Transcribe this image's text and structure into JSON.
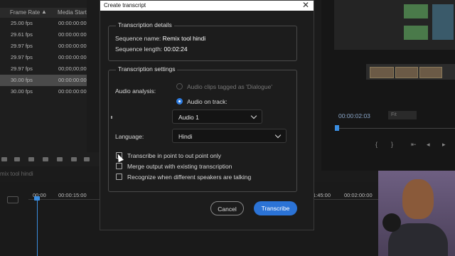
{
  "project_panel": {
    "columns": [
      "Frame Rate",
      "Media Start"
    ],
    "rows": [
      {
        "frame_rate": "25.00 fps",
        "media_start": "00:00:00:00"
      },
      {
        "frame_rate": "29.61 fps",
        "media_start": "00:00:00:00"
      },
      {
        "frame_rate": "29.97 fps",
        "media_start": "00:00:00:00"
      },
      {
        "frame_rate": "29.97 fps",
        "media_start": "00:00:00:00"
      },
      {
        "frame_rate": "29.97 fps",
        "media_start": "00;00;00;00"
      },
      {
        "frame_rate": "30.00 fps",
        "media_start": "00:00:00:00"
      },
      {
        "frame_rate": "30.00 fps",
        "media_start": "00:00:00:00"
      }
    ]
  },
  "timeline": {
    "sequence_tab": "mix tool hindi",
    "timecodes": [
      "00:00",
      "00:00:15:00",
      "1:45:00",
      "00:02:00:00"
    ]
  },
  "monitor": {
    "timecode": "00:00:02:03",
    "zoom": "Fit"
  },
  "dialog": {
    "title": "Create transcript",
    "close_glyph": "✕",
    "details": {
      "legend": "Transcription details",
      "sequence_name_label": "Sequence name:",
      "sequence_name_value": "Remix tool hindi",
      "sequence_length_label": "Sequence length:",
      "sequence_length_value": "00:02:24"
    },
    "settings": {
      "legend": "Transcription settings",
      "audio_analysis_label": "Audio analysis:",
      "option_clips_tagged": "Audio clips tagged as 'Dialogue'",
      "option_audio_on_track": "Audio on track:",
      "track_value": "Audio 1",
      "language_label": "Language:",
      "language_value": "Hindi",
      "check_in_out": "Transcribe in point to out point only",
      "check_merge": "Merge output with existing transcription",
      "check_speakers": "Recognize when different speakers are talking"
    },
    "cancel_label": "Cancel",
    "transcribe_label": "Transcribe"
  },
  "colors": {
    "accent": "#2b73d6",
    "playhead": "#3a8de0",
    "dialog_bg": "#1c1c1c"
  }
}
